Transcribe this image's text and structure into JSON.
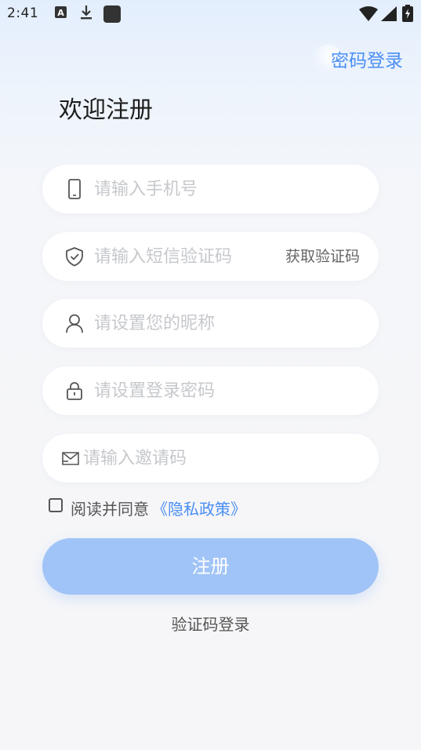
{
  "status_bar": {
    "time": "2:41",
    "icons": [
      "notification-a-icon",
      "download-icon",
      "app-square-icon",
      "wifi-icon",
      "cell-signal-icon",
      "battery-charging-icon"
    ]
  },
  "header": {
    "switch_login_label": "密码登录",
    "title": "欢迎注册"
  },
  "form": {
    "phone": {
      "placeholder": "请输入手机号",
      "value": "",
      "icon": "phone-icon"
    },
    "sms_code": {
      "placeholder": "请输入短信验证码",
      "value": "",
      "icon": "shield-check-icon",
      "action_label": "获取验证码"
    },
    "nickname": {
      "placeholder": "请设置您的昵称",
      "value": "",
      "icon": "user-icon"
    },
    "password": {
      "placeholder": "请设置登录密码",
      "value": "",
      "icon": "lock-icon"
    },
    "invite": {
      "placeholder": "请输入邀请码",
      "value": "",
      "icon": "mail-icon"
    }
  },
  "agreement": {
    "checked": false,
    "text": "阅读并同意",
    "policy_link": "《隐私政策》"
  },
  "actions": {
    "register_label": "注册",
    "code_login_label": "验证码登录"
  },
  "colors": {
    "accent": "#4a8ef3",
    "button_disabled": "#a0c4f7",
    "placeholder": "#c6c8cc",
    "field_bg": "#ffffff"
  }
}
